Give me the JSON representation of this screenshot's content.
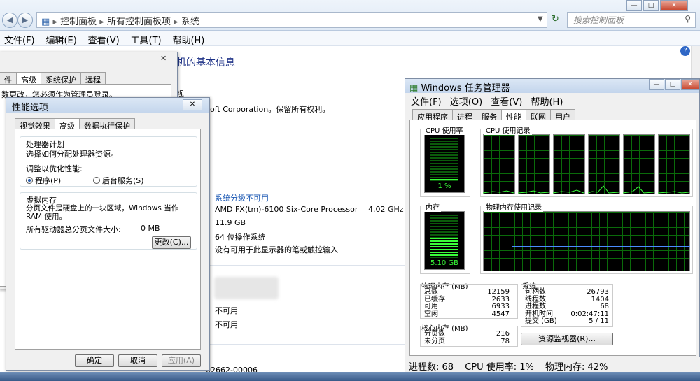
{
  "window_controls": {
    "minimize": "—",
    "maximize": "□",
    "close": "✕"
  },
  "explorer": {
    "breadcrumb": [
      "控制面板",
      "所有控制面板项",
      "系统"
    ],
    "search_placeholder": "搜索控制面板",
    "menu": [
      "文件(F)",
      "编辑(E)",
      "查看(V)",
      "工具(T)",
      "帮助(H)"
    ],
    "heading_fragment": "机的基本信息",
    "copyright_fragment1": "视",
    "copyright_fragment2": "oft Corporation。保留所有权利。",
    "rating_link": "系统分级不可用",
    "processor": "AMD FX(tm)-6100 Six-Core Processor",
    "processor_speed": "4.02 GHz",
    "memory": "11.9 GB",
    "system_type": "64 位操作系统",
    "pen_touch": "没有可用于此显示器的笔或触控输入",
    "not_available_1": "不可用",
    "not_available_2": "不可用",
    "product_id_fragment": "02662-00006"
  },
  "sysprops": {
    "tabs": [
      "件",
      "高级",
      "系统保护",
      "远程"
    ],
    "active_tab": "高级",
    "admin_note": "数更改，您必须作为管理员登录。"
  },
  "perf_dialog": {
    "title": "性能选项",
    "tabs": [
      "视觉效果",
      "高级",
      "数据执行保护"
    ],
    "active_tab": "高级",
    "cpu_group_title": "处理器计划",
    "cpu_group_desc": "选择如何分配处理器资源。",
    "adjust_label": "调整以优化性能:",
    "radio_programs": "程序(P)",
    "radio_services": "后台服务(S)",
    "vm_group_title": "虚拟内存",
    "vm_desc": "分页文件是硬盘上的一块区域，Windows 当作 RAM 使用。",
    "vm_total_label": "所有驱动器总分页文件大小:",
    "vm_total_value": "0 MB",
    "change_button": "更改(C)...",
    "ok_button": "确定",
    "cancel_button": "取消",
    "apply_button": "应用(A)"
  },
  "task_manager": {
    "title": "Windows 任务管理器",
    "menu": [
      "文件(F)",
      "选项(O)",
      "查看(V)",
      "帮助(H)"
    ],
    "tabs": [
      "应用程序",
      "进程",
      "服务",
      "性能",
      "联网",
      "用户"
    ],
    "active_tab": "性能",
    "cpu_usage_label": "CPU 使用率",
    "cpu_history_label": "CPU 使用记录",
    "cpu_value": "1 %",
    "cpu_fraction": 0.01,
    "mem_label": "内存",
    "mem_history_label": "物理内存使用记录",
    "mem_value": "5.10 GB",
    "mem_fraction": 0.43,
    "phys_title": "物理内存 (MB)",
    "phys": [
      [
        "总数",
        "12159"
      ],
      [
        "已缓存",
        "2633"
      ],
      [
        "可用",
        "6933"
      ],
      [
        "空闲",
        "4547"
      ]
    ],
    "kernel_title": "核心内存 (MB)",
    "kernel": [
      [
        "分页数",
        "216"
      ],
      [
        "未分页",
        "78"
      ]
    ],
    "sys_title": "系统",
    "sys": [
      [
        "句柄数",
        "26793"
      ],
      [
        "线程数",
        "1404"
      ],
      [
        "进程数",
        "68"
      ],
      [
        "开机时间",
        "0:02:47:11"
      ],
      [
        "提交 (GB)",
        "5 / 11"
      ]
    ],
    "resmon_button": "资源监视器(R)...",
    "status_processes": "进程数: 68",
    "status_cpu": "CPU 使用率: 1%",
    "status_mem": "物理内存: 42%"
  }
}
